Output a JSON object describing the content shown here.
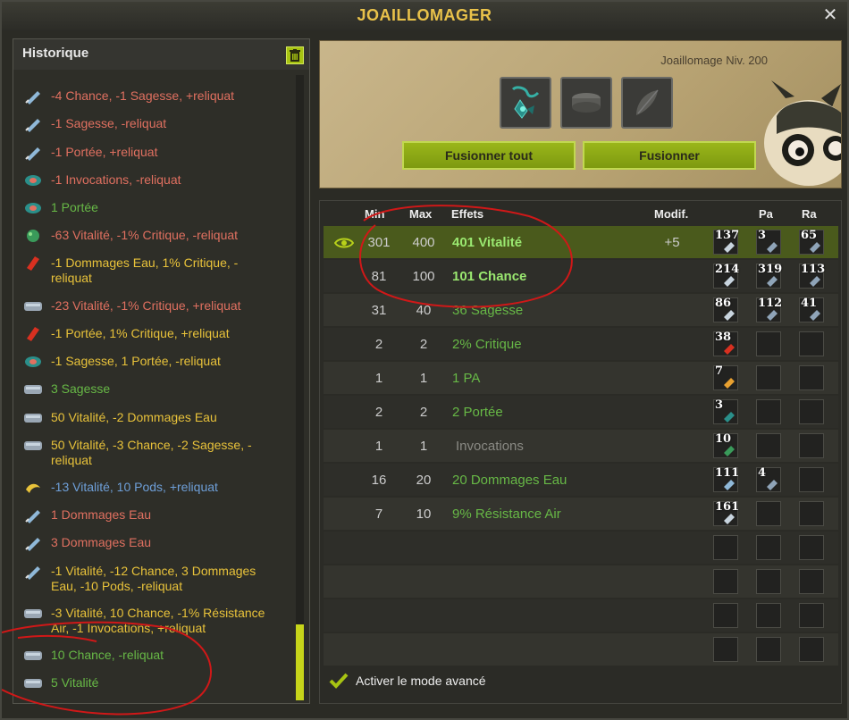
{
  "window": {
    "title": "JOAILLOMAGER"
  },
  "history": {
    "title": "Historique",
    "items": [
      {
        "text": "-4 Chance, -1 Sagesse, +reliquat",
        "color": "red",
        "icon": "rune-icon"
      },
      {
        "text": "-1 Sagesse, -reliquat",
        "color": "red",
        "icon": "rune-icon"
      },
      {
        "text": "-1 Portée, +reliquat",
        "color": "red",
        "icon": "rune-icon"
      },
      {
        "text": "-1 Invocations, -reliquat",
        "color": "red",
        "icon": "rune-icon"
      },
      {
        "text": "1 Portée",
        "color": "green",
        "icon": "rune-icon"
      },
      {
        "text": "-63 Vitalité, -1% Critique, -reliquat",
        "color": "red",
        "icon": "rune-icon"
      },
      {
        "text": "-1 Dommages Eau, 1% Critique, -",
        "text2": "reliquat",
        "color": "yellow",
        "icon": "rune-icon"
      },
      {
        "text": "-23 Vitalité, -1% Critique, +reliquat",
        "color": "red",
        "icon": "rune-icon"
      },
      {
        "text": "-1 Portée, 1% Critique, +reliquat",
        "color": "yellow",
        "icon": "rune-icon"
      },
      {
        "text": "-1 Sagesse, 1 Portée, -reliquat",
        "color": "yellow",
        "icon": "rune-icon"
      },
      {
        "text": "3 Sagesse",
        "color": "green",
        "icon": "rune-icon"
      },
      {
        "text": "50 Vitalité, -2 Dommages Eau",
        "color": "yellow",
        "icon": "rune-icon"
      },
      {
        "text": "50 Vitalité, -3 Chance, -2 Sagesse, -",
        "text2": "reliquat",
        "color": "yellow",
        "icon": "rune-icon"
      },
      {
        "text": "-13 Vitalité, 10 Pods, +reliquat",
        "color": "blue",
        "icon": "rune-icon"
      },
      {
        "text": "1 Dommages Eau",
        "color": "red",
        "icon": "rune-icon"
      },
      {
        "text": "3 Dommages Eau",
        "color": "red",
        "icon": "rune-icon"
      },
      {
        "text": "-1 Vitalité, -12 Chance, 3 Dommages",
        "text2": "Eau, -10 Pods, -reliquat",
        "color": "yellow",
        "icon": "rune-icon"
      },
      {
        "text": "-3 Vitalité, 10 Chance, -1% Résistance",
        "text2": "Air, -1 Invocations, +reliquat",
        "color": "yellow",
        "icon": "rune-icon"
      },
      {
        "text": "10 Chance, -reliquat",
        "color": "green",
        "icon": "rune-icon"
      },
      {
        "text": "5 Vitalité",
        "color": "green",
        "icon": "rune-icon"
      }
    ]
  },
  "craft": {
    "level_label": "Joaillomage Niv. 200",
    "fuse_all_label": "Fusionner tout",
    "fuse_label": "Fusionner"
  },
  "table": {
    "headers": {
      "min": "Min",
      "max": "Max",
      "effects": "Effets",
      "modif": "Modif.",
      "pa": "Pa",
      "ra": "Ra"
    },
    "rows": [
      {
        "min": "301",
        "max": "400",
        "effect": "401 Vitalité",
        "modif": "+5",
        "runes": [
          "137",
          "3",
          "65"
        ],
        "state": "highlight"
      },
      {
        "min": "81",
        "max": "100",
        "effect": "101 Chance",
        "modif": "",
        "runes": [
          "214",
          "319",
          "113"
        ],
        "state": "bright"
      },
      {
        "min": "31",
        "max": "40",
        "effect": "36 Sagesse",
        "modif": "",
        "runes": [
          "86",
          "112",
          "41"
        ],
        "state": "normal"
      },
      {
        "min": "2",
        "max": "2",
        "effect": "2% Critique",
        "modif": "",
        "runes": [
          "38",
          "",
          ""
        ],
        "state": "normal"
      },
      {
        "min": "1",
        "max": "1",
        "effect": "1 PA",
        "modif": "",
        "runes": [
          "7",
          "",
          ""
        ],
        "state": "normal"
      },
      {
        "min": "2",
        "max": "2",
        "effect": "2 Portée",
        "modif": "",
        "runes": [
          "3",
          "",
          ""
        ],
        "state": "normal"
      },
      {
        "min": "1",
        "max": "1",
        "effect": "Invocations",
        "modif": "",
        "runes": [
          "10",
          "",
          ""
        ],
        "state": "grey"
      },
      {
        "min": "16",
        "max": "20",
        "effect": "20 Dommages Eau",
        "modif": "",
        "runes": [
          "111",
          "4",
          ""
        ],
        "state": "normal"
      },
      {
        "min": "7",
        "max": "10",
        "effect": "9% Résistance Air",
        "modif": "",
        "runes": [
          "161",
          "",
          ""
        ],
        "state": "normal"
      }
    ],
    "advanced_label": "Activer le mode avancé"
  },
  "colors": {
    "accent_green": "#a7c312",
    "title_gold": "#e9c24a",
    "effect_green": "#67b846",
    "history_red": "#e07060",
    "history_yellow": "#e8c23a",
    "history_blue": "#6e9fd8"
  }
}
